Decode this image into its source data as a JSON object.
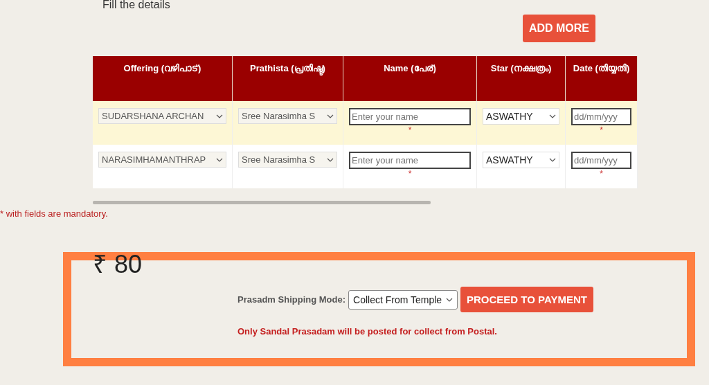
{
  "section_title": "Fill the details",
  "add_button": "ADD MORE",
  "table": {
    "columns": [
      {
        "label": "Offering (വഴിപാട്)"
      },
      {
        "label": "Prathista (പ്രതിഷ്ട)"
      },
      {
        "label": "Name (പേര്)"
      },
      {
        "label": "Star (നക്ഷത്രം)"
      },
      {
        "label": "Date (തിയ്യതി)"
      }
    ],
    "rows": [
      {
        "highlighted": true,
        "offering": "SUDARSHANA ARCHAN",
        "prathista": "Sree Narasimha S",
        "name_placeholder": "Enter your name",
        "name_required": "*",
        "star": "ASWATHY",
        "date_placeholder": "dd/mm/yyy",
        "date_required": "*"
      },
      {
        "highlighted": false,
        "offering": "NARASIMHAMANTHRAP",
        "prathista": "Sree Narasimha S",
        "name_placeholder": "Enter your name",
        "name_required": "*",
        "star": "ASWATHY",
        "date_placeholder": "dd/mm/yyy",
        "date_required": "*"
      }
    ]
  },
  "mandatory_note": "* with fields are mandatory.",
  "total": "₹ 80",
  "shipping": {
    "label": "Prasadm Shipping Mode:",
    "value": "Collect From Temple"
  },
  "proceed_button": "PROCEED TO PAYMENT",
  "shipping_note": "Only Sandal Prasadam will be posted for collect from Postal."
}
